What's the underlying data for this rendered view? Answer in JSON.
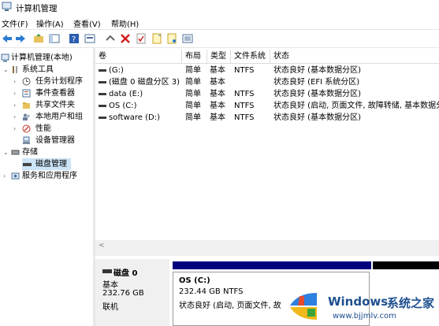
{
  "window": {
    "title": "计算机管理"
  },
  "menu": [
    "文件(F)",
    "操作(A)",
    "查看(V)",
    "帮助(H)"
  ],
  "toolbar": {
    "icons": [
      "back-arrow-icon",
      "forward-arrow-icon",
      "up-folder-icon",
      "show-hide-tree-icon",
      "help-icon",
      "properties-icon",
      "connect-icon",
      "delete-icon",
      "check-icon",
      "new-icon",
      "open-icon",
      "settings-list-icon"
    ]
  },
  "tree": {
    "root": "计算机管理(本地)",
    "system_tools": "系统工具",
    "task_scheduler": "任务计划程序",
    "event_viewer": "事件查看器",
    "shared_folders": "共享文件夹",
    "local_users": "本地用户和组",
    "performance": "性能",
    "device_manager": "设备管理器",
    "storage": "存储",
    "disk_management": "磁盘管理",
    "services_apps": "服务和应用程序"
  },
  "columns": [
    "卷",
    "布局",
    "类型",
    "文件系统",
    "状态"
  ],
  "volumes": [
    {
      "name": "(G:)",
      "layout": "简单",
      "type": "基本",
      "fs": "NTFS",
      "status": "状态良好 (基本数据分区)"
    },
    {
      "name": "(磁盘 0 磁盘分区 3)",
      "layout": "简单",
      "type": "基本",
      "fs": "",
      "status": "状态良好 (EFI 系统分区)"
    },
    {
      "name": "data (E:)",
      "layout": "简单",
      "type": "基本",
      "fs": "NTFS",
      "status": "状态良好 (基本数据分区)"
    },
    {
      "name": "OS (C:)",
      "layout": "简单",
      "type": "基本",
      "fs": "NTFS",
      "status": "状态良好 (启动, 页面文件, 故障转储, 基本数据分"
    },
    {
      "name": "software (D:)",
      "layout": "简单",
      "type": "基本",
      "fs": "NTFS",
      "status": "状态良好 (基本数据分区)"
    }
  ],
  "disk": {
    "name": "磁盘 0",
    "type": "基本",
    "size": "232.76 GB",
    "state": "联机",
    "partition": {
      "title": "OS  (C:)",
      "size": "232.44 GB NTFS",
      "status": "状态良好 (启动, 页面文件, 故"
    }
  },
  "watermark": {
    "brand": "Windows",
    "brand_cn": "系统之家",
    "url": "www.bjjmlv.com"
  },
  "colors": {
    "primary_partition": "#00007f",
    "unallocated": "#000000",
    "selection": "#cce4f7"
  }
}
